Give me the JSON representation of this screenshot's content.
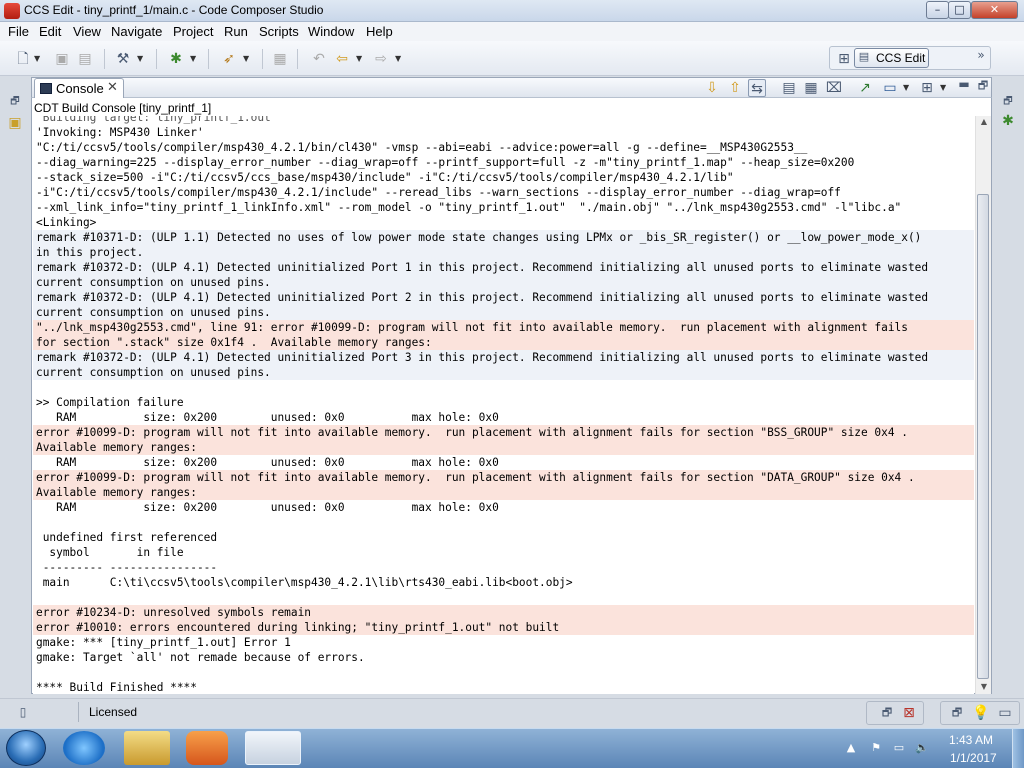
{
  "window": {
    "title": "CCS Edit - tiny_printf_1/main.c - Code Composer Studio",
    "minimize_label": "–",
    "maximize_label": "□",
    "close_label": "✕"
  },
  "menu": [
    "File",
    "Edit",
    "View",
    "Navigate",
    "Project",
    "Run",
    "Scripts",
    "Window",
    "Help"
  ],
  "perspective": {
    "label": "CCS Edit"
  },
  "console": {
    "tab_label": "Console",
    "title": "CDT Build Console [tiny_printf_1]",
    "lines": [
      "'Invoking: MSP430 Linker'",
      "\"C:/ti/ccsv5/tools/compiler/msp430_4.2.1/bin/cl430\" -vmsp --abi=eabi --advice:power=all -g --define=__MSP430G2553__",
      "--diag_warning=225 --display_error_number --diag_wrap=off --printf_support=full -z -m\"tiny_printf_1.map\" --heap_size=0x200",
      "--stack_size=500 -i\"C:/ti/ccsv5/ccs_base/msp430/include\" -i\"C:/ti/ccsv5/tools/compiler/msp430_4.2.1/lib\"",
      "-i\"C:/ti/ccsv5/tools/compiler/msp430_4.2.1/include\" --reread_libs --warn_sections --display_error_number --diag_wrap=off",
      "--xml_link_info=\"tiny_printf_1_linkInfo.xml\" --rom_model -o \"tiny_printf_1.out\"  \"./main.obj\" \"../lnk_msp430g2553.cmd\" -l\"libc.a\"",
      "<Linking>",
      "remark #10371-D: (ULP 1.1) Detected no uses of low power mode state changes using LPMx or _bis_SR_register() or __low_power_mode_x()",
      "in this project.",
      "remark #10372-D: (ULP 4.1) Detected uninitialized Port 1 in this project. Recommend initializing all unused ports to eliminate wasted",
      "current consumption on unused pins.",
      "remark #10372-D: (ULP 4.1) Detected uninitialized Port 2 in this project. Recommend initializing all unused ports to eliminate wasted",
      "current consumption on unused pins.",
      "\"../lnk_msp430g2553.cmd\", line 91: error #10099-D: program will not fit into available memory.  run placement with alignment fails",
      "for section \".stack\" size 0x1f4 .  Available memory ranges:",
      "remark #10372-D: (ULP 4.1) Detected uninitialized Port 3 in this project. Recommend initializing all unused ports to eliminate wasted",
      "current consumption on unused pins.",
      "",
      ">> Compilation failure",
      "   RAM          size: 0x200        unused: 0x0          max hole: 0x0",
      "error #10099-D: program will not fit into available memory.  run placement with alignment fails for section \"BSS_GROUP\" size 0x4 .",
      "Available memory ranges:",
      "   RAM          size: 0x200        unused: 0x0          max hole: 0x0",
      "error #10099-D: program will not fit into available memory.  run placement with alignment fails for section \"DATA_GROUP\" size 0x4 .",
      "Available memory ranges:",
      "   RAM          size: 0x200        unused: 0x0          max hole: 0x0",
      "",
      " undefined first referenced",
      "  symbol       in file",
      " --------- ----------------",
      " main      C:\\ti\\ccsv5\\tools\\compiler\\msp430_4.2.1\\lib\\rts430_eabi.lib<boot.obj>",
      "",
      "error #10234-D: unresolved symbols remain",
      "error #10010: errors encountered during linking; \"tiny_printf_1.out\" not built",
      "gmake: *** [tiny_printf_1.out] Error 1",
      "gmake: Target `all' not remade because of errors.",
      "",
      "**** Build Finished ****"
    ]
  },
  "status": {
    "text": "Licensed"
  },
  "clock": {
    "time": "1:43 AM",
    "date": "1/1/2017"
  },
  "colors": {
    "remark_band": "#eef2f8",
    "error_band": "#fbe3dc"
  }
}
